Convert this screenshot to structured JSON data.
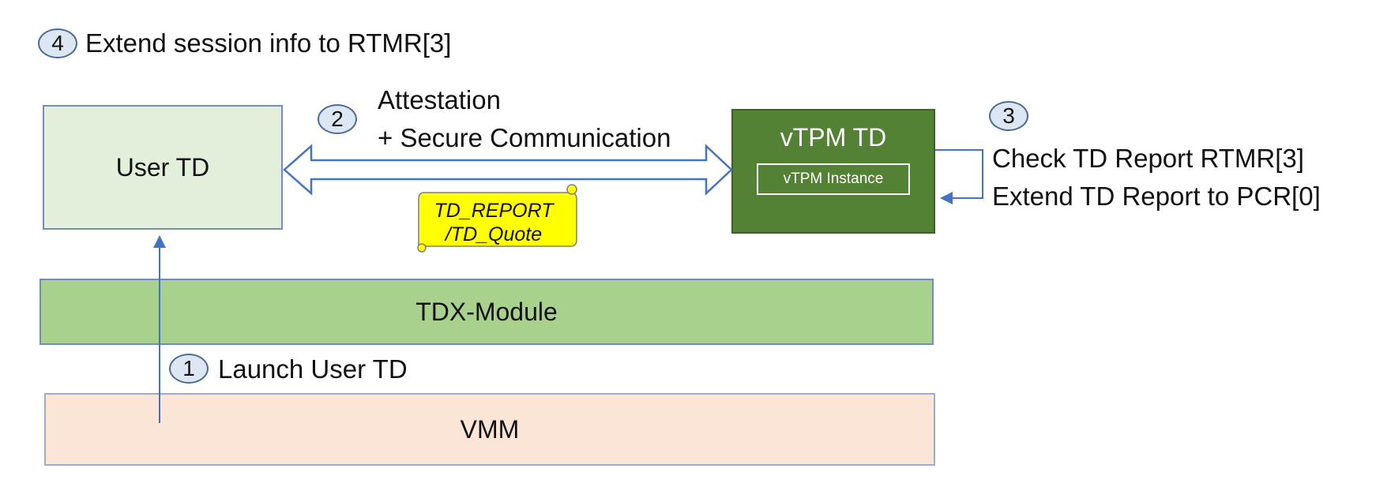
{
  "steps": {
    "step1": {
      "number": "1",
      "text": "Launch User TD"
    },
    "step2": {
      "number": "2",
      "line1": "Attestation",
      "line2": "+ Secure Communication"
    },
    "step3": {
      "number": "3",
      "line1": "Check TD Report RTMR[3]",
      "line2": "Extend TD Report to PCR[0]"
    },
    "step4": {
      "number": "4",
      "text": "Extend session info to RTMR[3]"
    }
  },
  "boxes": {
    "user_td": "User TD",
    "vtpm_td": "vTPM TD",
    "vtpm_instance": "vTPM Instance",
    "tdx_module": "TDX-Module",
    "vmm": "VMM"
  },
  "scroll": {
    "line1": "TD_REPORT",
    "line2": "/TD_Quote"
  },
  "colors": {
    "user_td": "#e2efda",
    "vtpm_td": "#548235",
    "tdx_module": "#a9d18e",
    "vmm": "#fbe5d6",
    "scroll": "#ffff00",
    "arrow": "#4472c4",
    "badge": "#dde7f3"
  }
}
